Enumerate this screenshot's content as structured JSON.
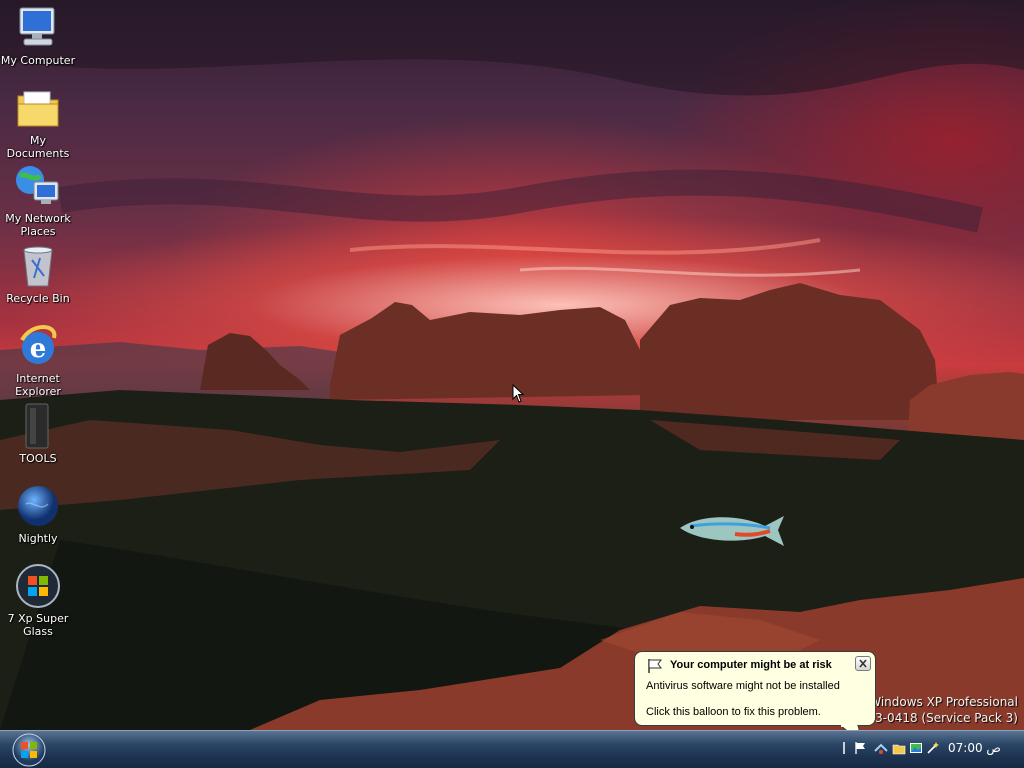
{
  "desktop": {
    "icons": [
      {
        "label": "My Computer",
        "icon": "my-computer-icon"
      },
      {
        "label": "My Documents",
        "icon": "my-documents-folder-icon"
      },
      {
        "label": "My Network\nPlaces",
        "icon": "network-places-icon"
      },
      {
        "label": "Recycle Bin",
        "icon": "recycle-bin-icon"
      },
      {
        "label": "Internet\nExplorer",
        "icon": "internet-explorer-icon"
      },
      {
        "label": "TOOLS",
        "icon": "tools-icon"
      },
      {
        "label": "Nightly",
        "icon": "nightly-globe-icon"
      },
      {
        "label": "7 Xp Super\nGlass",
        "icon": "windows-orb-icon"
      }
    ],
    "watermark": {
      "line1": "Windows XP Professional",
      "line2": "130503-0418 (Service Pack 3)"
    }
  },
  "balloon": {
    "title": "Your computer might be at risk",
    "line1": "Antivirus software might not be installed",
    "line2": "Click this balloon to fix this problem."
  },
  "taskbar": {
    "clock": "07:00 ص",
    "tray_icons": [
      "flag-icon",
      "network-icon",
      "folder-icon",
      "image-icon",
      "wand-icon"
    ]
  },
  "colors": {
    "balloon_bg": "#ffffe1",
    "taskbar_top": "#5a7392",
    "taskbar_bottom": "#152a43"
  }
}
